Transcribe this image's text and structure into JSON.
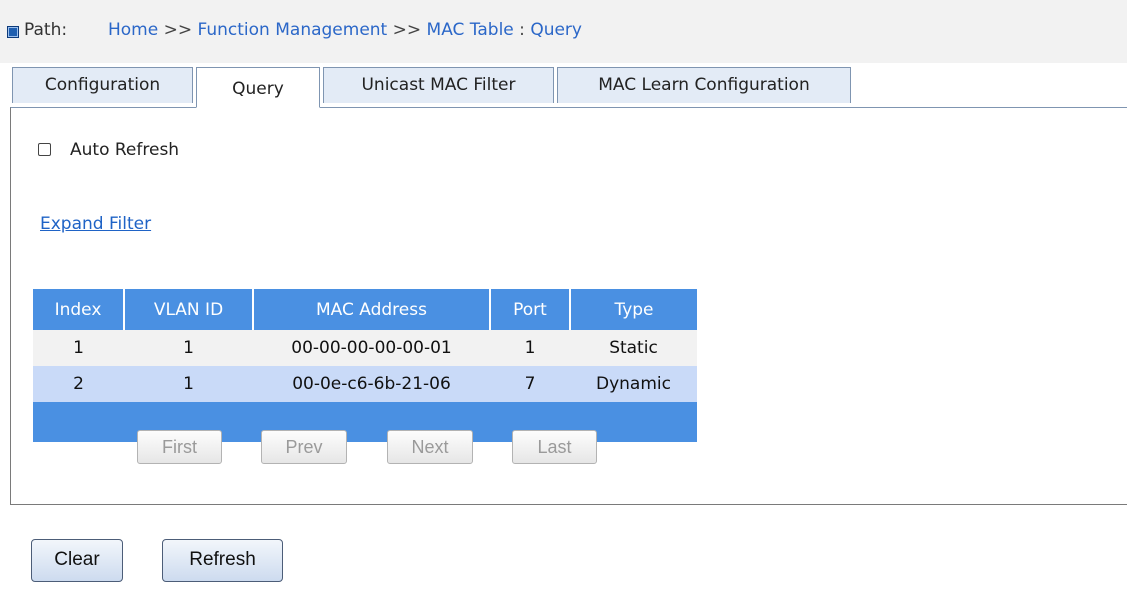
{
  "path": {
    "label": "Path:",
    "crumbs": [
      "Home",
      "Function Management",
      "MAC Table",
      "Query"
    ],
    "separator": ">>",
    "colon": ":"
  },
  "tabs": [
    {
      "label": "Configuration",
      "active": false
    },
    {
      "label": "Query",
      "active": true
    },
    {
      "label": "Unicast MAC Filter",
      "active": false
    },
    {
      "label": "MAC Learn Configuration",
      "active": false
    }
  ],
  "auto_refresh": {
    "label": "Auto Refresh",
    "checked": false
  },
  "expand_filter": "Expand Filter",
  "table": {
    "headers": [
      "Index",
      "VLAN ID",
      "MAC Address",
      "Port",
      "Type"
    ],
    "rows": [
      [
        "1",
        "1",
        "00-00-00-00-00-01",
        "1",
        "Static"
      ],
      [
        "2",
        "1",
        "00-0e-c6-6b-21-06",
        "7",
        "Dynamic"
      ]
    ]
  },
  "pager": {
    "first": "First",
    "prev": "Prev",
    "next": "Next",
    "last": "Last"
  },
  "buttons": {
    "clear": "Clear",
    "refresh": "Refresh"
  },
  "colors": {
    "header_blue": "#4a90e2",
    "row_alt": "#c9daf8",
    "link": "#1f63c6"
  }
}
